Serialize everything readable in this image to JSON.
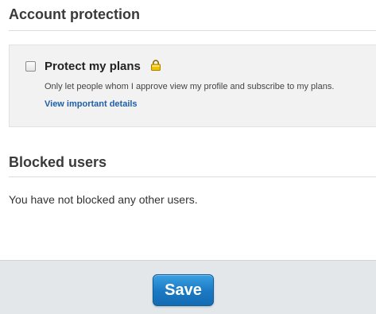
{
  "account_protection": {
    "title": "Account protection",
    "protect_label": "Protect my plans",
    "protect_checked": false,
    "description": "Only let people whom I approve view my profile and subscribe to my plans.",
    "details_link": "View important details",
    "lock_icon": "lock-icon"
  },
  "blocked_users": {
    "title": "Blocked users",
    "message": "You have not blocked any other users."
  },
  "footer": {
    "save_label": "Save"
  },
  "colors": {
    "link": "#1f5fa6",
    "save_button": "#1a78c2",
    "lock": "#e8b800",
    "footer_background": "#e3e7ea"
  }
}
